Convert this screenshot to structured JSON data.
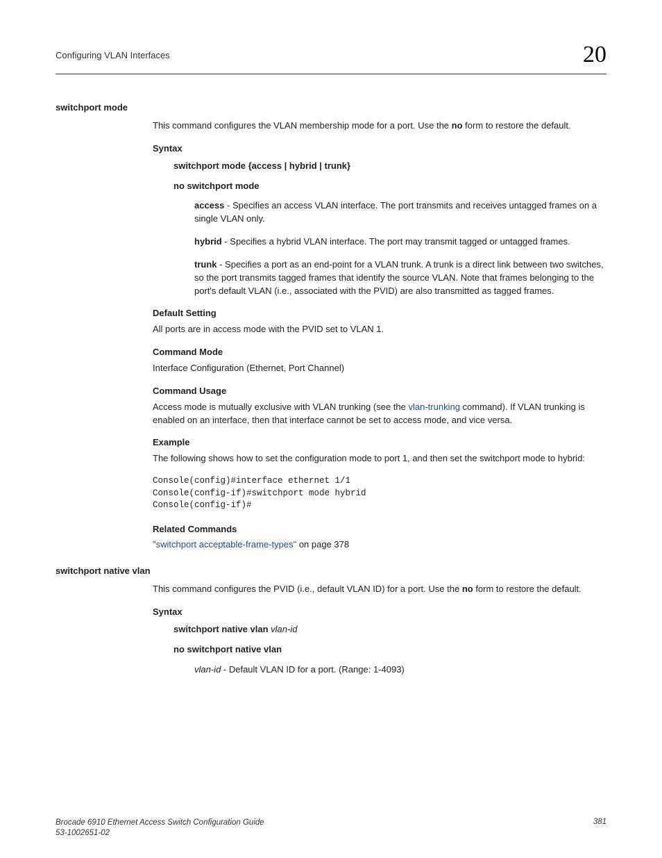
{
  "header": {
    "section": "Configuring VLAN Interfaces",
    "chapter": "20"
  },
  "cmd1": {
    "title": "switchport mode",
    "intro_a": "This command configures the VLAN membership mode for a port. Use the ",
    "intro_bold": "no",
    "intro_b": " form to restore the default.",
    "syntax_head": "Syntax",
    "syntax_line": "switchport mode {access | hybrid | trunk}",
    "no_line": "no switchport mode",
    "access_term": "access",
    "access_text": " - Specifies an access VLAN interface. The port transmits and receives untagged frames on a single VLAN only.",
    "hybrid_term": "hybrid",
    "hybrid_text": " - Specifies a hybrid VLAN interface. The port may transmit tagged or untagged frames.",
    "trunk_term": "trunk",
    "trunk_text": " - Specifies a port as an end-point for a VLAN trunk. A trunk is a direct link between two switches, so the port transmits tagged frames that identify the source VLAN. Note that frames belonging to the port's default VLAN (i.e., associated with the PVID) are also transmitted as tagged frames.",
    "default_head": "Default Setting",
    "default_text": "All ports are in access mode with the PVID set to VLAN 1.",
    "mode_head": "Command Mode",
    "mode_text": "Interface Configuration (Ethernet, Port Channel)",
    "usage_head": "Command Usage",
    "usage_a": "Access mode is mutually exclusive with VLAN trunking (see the ",
    "usage_link": "vlan-trunking",
    "usage_b": " command). If VLAN trunking is enabled on an interface, then that interface cannot be set to access mode, and vice versa.",
    "example_head": "Example",
    "example_text": "The following shows how to set the configuration mode to port 1, and then set the switchport mode to hybrid:",
    "example_code": "Console(config)#interface ethernet 1/1\nConsole(config-if)#switchport mode hybrid\nConsole(config-if)#",
    "related_head": "Related Commands",
    "related_link": "\"switchport acceptable-frame-types\"",
    "related_suffix": " on page 378"
  },
  "cmd2": {
    "title": "switchport native vlan",
    "intro_a": "This command configures the PVID (i.e., default VLAN ID) for a port. Use the ",
    "intro_bold": "no",
    "intro_b": " form to restore the default.",
    "syntax_head": "Syntax",
    "syntax_bold": "switchport native vlan ",
    "syntax_italic": "vlan-id",
    "no_line": "no switchport native vlan",
    "param_italic": "vlan-id",
    "param_text": " - Default VLAN ID for a port. (Range: 1-4093)"
  },
  "footer": {
    "line1": "Brocade 6910 Ethernet Access Switch Configuration Guide",
    "line2": "53-1002651-02",
    "page": "381"
  }
}
